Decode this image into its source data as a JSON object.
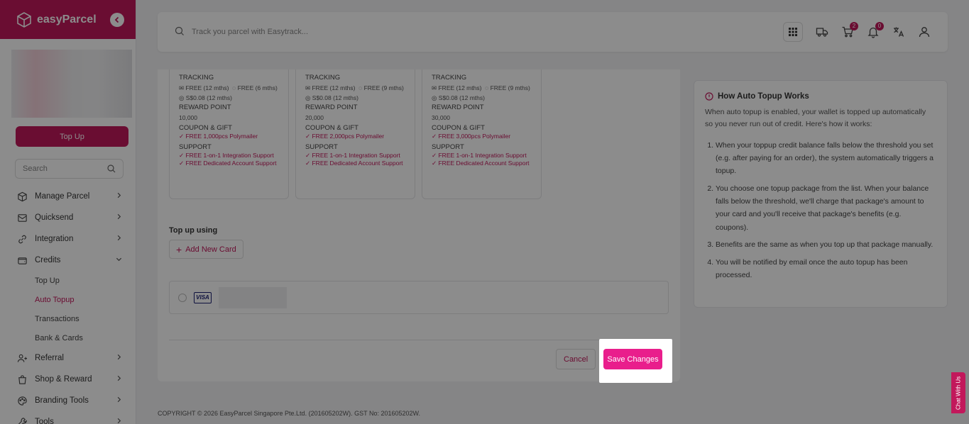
{
  "sidebar": {
    "brand": "easyParcel",
    "topup_button": "Top Up",
    "search_placeholder": "Search",
    "nav": [
      {
        "label": "Manage Parcel",
        "icon": "box-icon"
      },
      {
        "label": "Quicksend",
        "icon": "send-icon"
      },
      {
        "label": "Integration",
        "icon": "link-icon"
      },
      {
        "label": "Credits",
        "icon": "wallet-icon"
      }
    ],
    "credits_sub": [
      "Top Up",
      "Auto Topup",
      "Transactions",
      "Bank & Cards"
    ],
    "nav_after": [
      {
        "label": "Referral",
        "icon": "users-icon"
      },
      {
        "label": "Shop & Reward",
        "icon": "bag-icon"
      },
      {
        "label": "Branding Tools",
        "icon": "palette-icon"
      },
      {
        "label": "Tools",
        "icon": "wrench-icon"
      }
    ]
  },
  "topbar": {
    "search_placeholder": "Track you parcel with Easytrack...",
    "cart_badge": "2",
    "bell_badge": "0"
  },
  "packages": [
    {
      "tracking_label": "TRACKING",
      "tracking_line1a": "FREE (12 mths)",
      "tracking_line1b": "FREE (6 mths)",
      "tracking_line2": "S$0.08 (12 mths)",
      "reward_label": "REWARD POINT",
      "reward": "10,000",
      "coupon_label": "COUPON & GIFT",
      "coupon": "FREE 1,000pcs Polymailer",
      "support_label": "SUPPORT",
      "support1": "FREE 1-on-1 Integration Support",
      "support2": "FREE Dedicated Account Support"
    },
    {
      "tracking_label": "TRACKING",
      "tracking_line1a": "FREE (12 mths)",
      "tracking_line1b": "FREE (9 mths)",
      "tracking_line2": "S$0.08 (12 mths)",
      "reward_label": "REWARD POINT",
      "reward": "20,000",
      "coupon_label": "COUPON & GIFT",
      "coupon": "FREE 2,000pcs Polymailer",
      "support_label": "SUPPORT",
      "support1": "FREE 1-on-1 Integration Support",
      "support2": "FREE Dedicated Account Support"
    },
    {
      "tracking_label": "TRACKING",
      "tracking_line1a": "FREE (12 mths)",
      "tracking_line1b": "FREE (9 mths)",
      "tracking_line2": "S$0.08 (12 mths)",
      "reward_label": "REWARD POINT",
      "reward": "30,000",
      "coupon_label": "COUPON & GIFT",
      "coupon": "FREE 3,000pcs Polymailer",
      "support_label": "SUPPORT",
      "support1": "FREE 1-on-1 Integration Support",
      "support2": "FREE Dedicated Account Support"
    }
  ],
  "payment": {
    "title": "Top up using",
    "add_card": "Add New Card",
    "card_brand": "VISA"
  },
  "actions": {
    "cancel": "Cancel",
    "save": "Save Changes"
  },
  "info": {
    "title": "How Auto Topup Works",
    "desc": "When auto topup is enabled, your wallet is topped up automatically so you never run out of credit. Here's how it works:",
    "steps": [
      "When your toppup credit balance falls below the threshold you set (e.g. after paying for an order), the system automatically triggers a topup.",
      "You choose one topup package from the list. When your balance falls below the threshold, we'll charge that package's amount to your card and you'll receive that package's benefits (e.g. coupons).",
      "Benefits are the same as when you top up that package manually.",
      "You will be notified by email once the auto topup has been processed."
    ]
  },
  "footer": {
    "copyright": "COPYRIGHT © 2026 EasyParcel Singapore Pte.Ltd. (201605202W). GST No: 201605202W."
  },
  "chat": {
    "label": "Chat With Us"
  },
  "colors": {
    "brand": "#c2185b",
    "save": "#e91e8c"
  }
}
